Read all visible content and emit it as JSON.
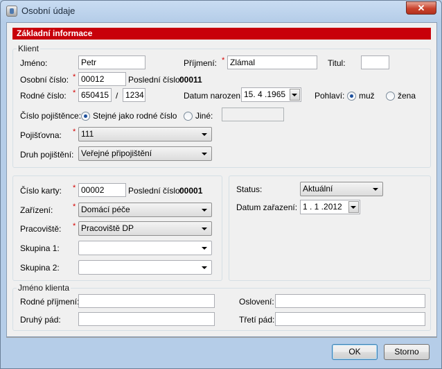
{
  "window": {
    "title": "Osobní údaje",
    "close_glyph": "✕"
  },
  "banner": "Základní informace",
  "klient": {
    "legend": "Klient",
    "jmeno_label": "Jméno:",
    "jmeno_value": "Petr",
    "prijmeni_label": "Příjmení:",
    "prijmeni_value": "Zlámal",
    "titul_label": "Titul:",
    "titul_value": "",
    "osobni_cislo_label": "Osobní číslo:",
    "osobni_cislo_value": "00012",
    "posledni_cislo_label": "Poslední číslo:",
    "posledni_cislo_value": "00011",
    "rodne_cislo_label": "Rodné číslo:",
    "rodne_cislo_part1": "650415",
    "rodne_cislo_sep": "/",
    "rodne_cislo_part2": "1234",
    "datum_narozeni_label": "Datum narození:",
    "datum_narozeni_value": "15. 4 .1965",
    "pohlavi_label": "Pohlaví:",
    "pohlavi_muz": "muž",
    "pohlavi_zena": "žena",
    "pohlavi_selected": "muž",
    "cislo_pojistence_label": "Číslo pojištěnce:",
    "stejne_label": "Stejné jako rodné číslo",
    "jine_label": "Jiné:",
    "jine_value": "",
    "pojistovna_label": "Pojišťovna:",
    "pojistovna_value": "111",
    "druh_pojisteni_label": "Druh pojištění:",
    "druh_pojisteni_value": "Veřejné připojištění"
  },
  "karta": {
    "cislo_karty_label": "Číslo karty:",
    "cislo_karty_value": "00002",
    "posledni_cislo_label": "Poslední číslo:",
    "posledni_cislo_value": "00001",
    "zarizeni_label": "Zařízení:",
    "zarizeni_value": "Domácí péče",
    "pracoviste_label": "Pracoviště:",
    "pracoviste_value": "Pracoviště DP",
    "skupina1_label": "Skupina 1:",
    "skupina1_value": "",
    "skupina2_label": "Skupina 2:",
    "skupina2_value": ""
  },
  "status": {
    "status_label": "Status:",
    "status_value": "Aktuální",
    "datum_zarazeni_label": "Datum zařazení:",
    "datum_zarazeni_value": "1 . 1 .2012"
  },
  "jmeno_klienta": {
    "legend": "Jméno klienta",
    "rodne_prijmeni_label": "Rodné příjmení:",
    "rodne_prijmeni_value": "",
    "osloveni_label": "Oslovení:",
    "osloveni_value": "",
    "druhy_pad_label": "Druhý pád:",
    "druhy_pad_value": "",
    "treti_pad_label": "Třetí pád:",
    "treti_pad_value": ""
  },
  "buttons": {
    "ok": "OK",
    "storno": "Storno"
  },
  "required_mark": "*"
}
